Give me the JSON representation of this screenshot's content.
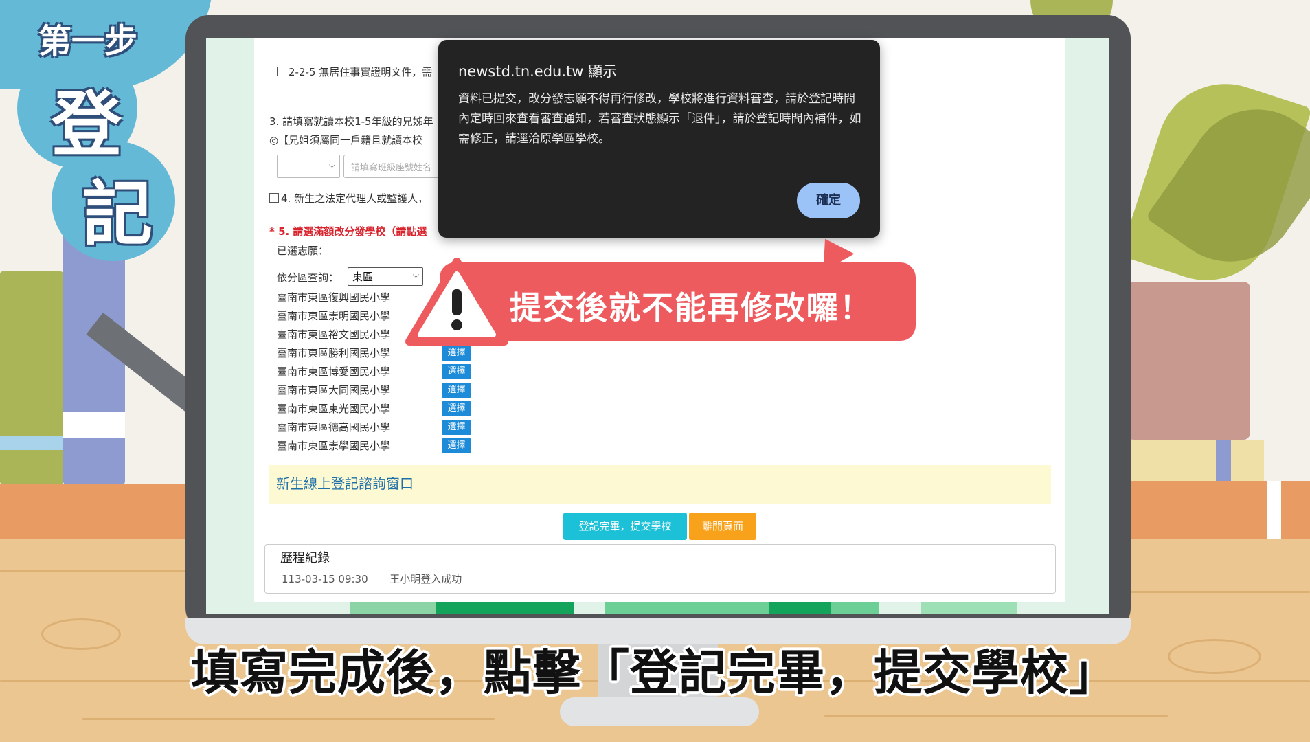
{
  "badge": {
    "step": "第一步",
    "char1": "登",
    "char2": "記"
  },
  "dialog": {
    "title": "newstd.tn.edu.tw 顯示",
    "body": "資料已提交，改分發志願不得再行修改，學校將進行資料審查，請於登記時間內定時回來查看審查通知，若審查狀態顯示「退件」，請於登記時間內補件，如需修正，請逕洽原學區學校。",
    "ok_label": "確定"
  },
  "callout": {
    "text": "提交後就不能再修改囉！"
  },
  "form": {
    "item_225": "2-2-5 無居住事實證明文件，需",
    "item_3": "3. 請填寫就讀本校1-5年級的兄姊年",
    "item_3_note": "◎【兄姐須屬同一戶籍且就讀本校",
    "sibling_placeholder": "請填寫班級座號姓名",
    "item_4": "4. 新生之法定代理人或監護人，",
    "item_5": "* 5. 請選滿額改分發學校（請點選",
    "selected_label": "已選志願：",
    "district_label": "依分區查詢：",
    "district_value": "東區",
    "choose_label": "選擇",
    "schools": [
      "臺南市東區復興國民小學",
      "臺南市東區崇明國民小學",
      "臺南市東區裕文國民小學",
      "臺南市東區勝利國民小學",
      "臺南市東區博愛國民小學",
      "臺南市東區大同國民小學",
      "臺南市東區東光國民小學",
      "臺南市東區德高國民小學",
      "臺南市東區崇學國民小學"
    ]
  },
  "notice": {
    "text": "新生線上登記諮詢窗口"
  },
  "actions": {
    "submit_label": "登記完畢，提交學校",
    "leave_label": "離開頁面"
  },
  "history": {
    "title": "歷程紀錄",
    "entry_time": "113-03-15 09:30",
    "entry_text": "王小明登入成功"
  },
  "caption": {
    "text": "填寫完成後，點擊「登記完畢，提交學校」"
  },
  "colors": {
    "badge_blue": "#64b9d6",
    "callout_red": "#ee5b5f",
    "dialog_bg": "#232323",
    "submit_cyan": "#1cc1d8",
    "leave_orange": "#f7a21a",
    "choose_blue": "#1d8bd7",
    "notice_yellow": "#fdf9d2"
  }
}
